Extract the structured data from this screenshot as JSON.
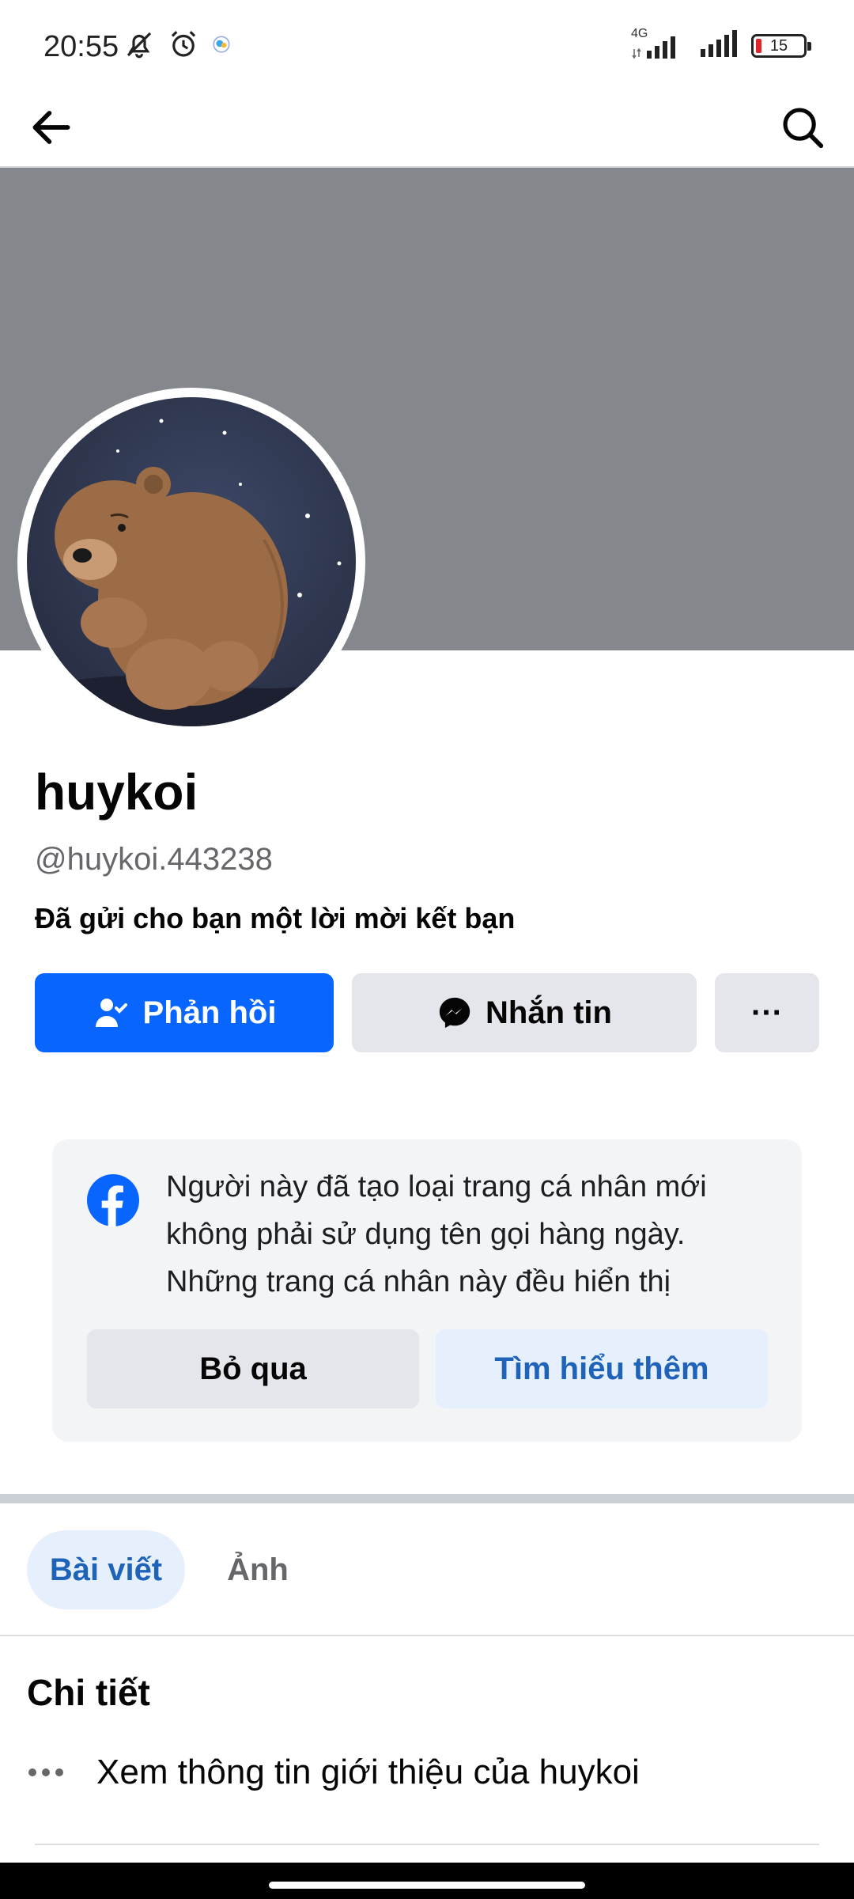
{
  "status_bar": {
    "time": "20:55",
    "network": "4G",
    "battery": "15",
    "battery_color": "#e0242c"
  },
  "profile": {
    "name": "huykoi",
    "handle": "@huykoi.443238",
    "request_text": "Đã gửi cho bạn một lời mời kết bạn"
  },
  "actions": {
    "respond_label": "Phản hồi",
    "message_label": "Nhắn tin",
    "more_label": "···"
  },
  "info_card": {
    "lines": [
      "Người này đã tạo loại trang cá nhân mới",
      "không phải sử dụng tên gọi hàng ngày.",
      "Những trang cá nhân này đều hiển thị"
    ],
    "skip_label": "Bỏ qua",
    "learn_more_label": "Tìm hiểu thêm"
  },
  "tabs": {
    "posts_label": "Bài viết",
    "photos_label": "Ảnh",
    "active": "posts"
  },
  "details": {
    "title": "Chi tiết",
    "intro_link": "Xem thông tin giới thiệu của huykoi"
  },
  "colors": {
    "primary": "#0866ff",
    "cover": "#84878c",
    "link_blue": "#1f63b9",
    "secondary_button": "#e4e6eb"
  },
  "icons": {
    "back": "arrow-left-icon",
    "search": "search-icon",
    "respond": "person-check-icon",
    "message": "messenger-icon",
    "card_logo": "facebook-logo-icon"
  }
}
